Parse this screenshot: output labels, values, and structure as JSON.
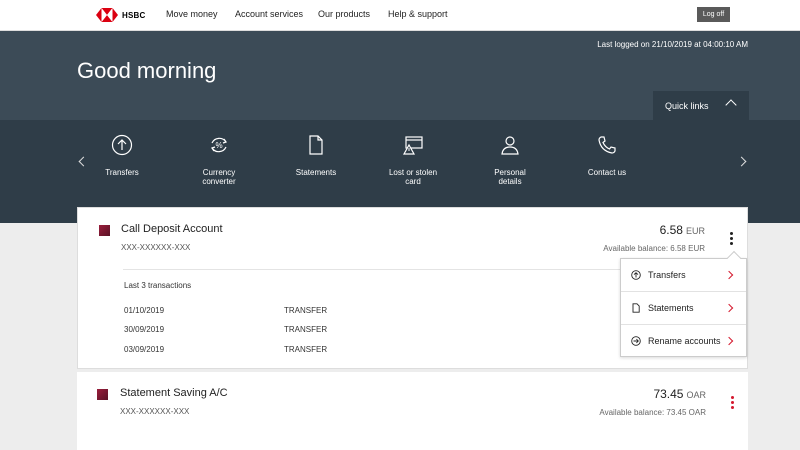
{
  "nav": {
    "brand": "HSBC",
    "items": [
      "Move money",
      "Account services",
      "Our products",
      "Help & support"
    ],
    "logoff": "Log off"
  },
  "header": {
    "last_logged": "Last logged on 21/10/2019 at 04:00:10 AM",
    "greeting": "Good morning",
    "quick_links": "Quick links"
  },
  "quick_links": [
    {
      "label": "Transfers",
      "icon": "arrow-up-circle-icon"
    },
    {
      "label": "Currency converter",
      "icon": "currency-converter-icon"
    },
    {
      "label": "Statements",
      "icon": "document-icon"
    },
    {
      "label": "Lost or stolen card",
      "icon": "card-warning-icon"
    },
    {
      "label": "Personal details",
      "icon": "person-icon"
    },
    {
      "label": "Contact us",
      "icon": "phone-icon"
    }
  ],
  "accounts": [
    {
      "name": "Call Deposit Account",
      "number": "XXX-XXXXXX-XXX",
      "amount": "6.58",
      "currency": "EUR",
      "available": "Available balance: 6.58 EUR"
    },
    {
      "name": "Statement Saving A/C",
      "number": "XXX-XXXXXX-XXX",
      "amount": "73.45",
      "currency": "OAR",
      "available": "Available balance: 73.45 OAR"
    }
  ],
  "transactions": {
    "title": "Last 3 transactions",
    "rows": [
      {
        "date": "01/10/2019",
        "type": "TRANSFER"
      },
      {
        "date": "30/09/2019",
        "type": "TRANSFER"
      },
      {
        "date": "03/09/2019",
        "type": "TRANSFER"
      }
    ]
  },
  "menu": {
    "items": [
      {
        "label": "Transfers",
        "icon": "arrow-up-circle-icon"
      },
      {
        "label": "Statements",
        "icon": "document-icon"
      },
      {
        "label": "Rename accounts",
        "icon": "arrow-right-circle-icon"
      }
    ]
  },
  "colors": {
    "hero": "#3c4b57",
    "quickbar": "#2f3d48",
    "accent": "#d4182e"
  }
}
